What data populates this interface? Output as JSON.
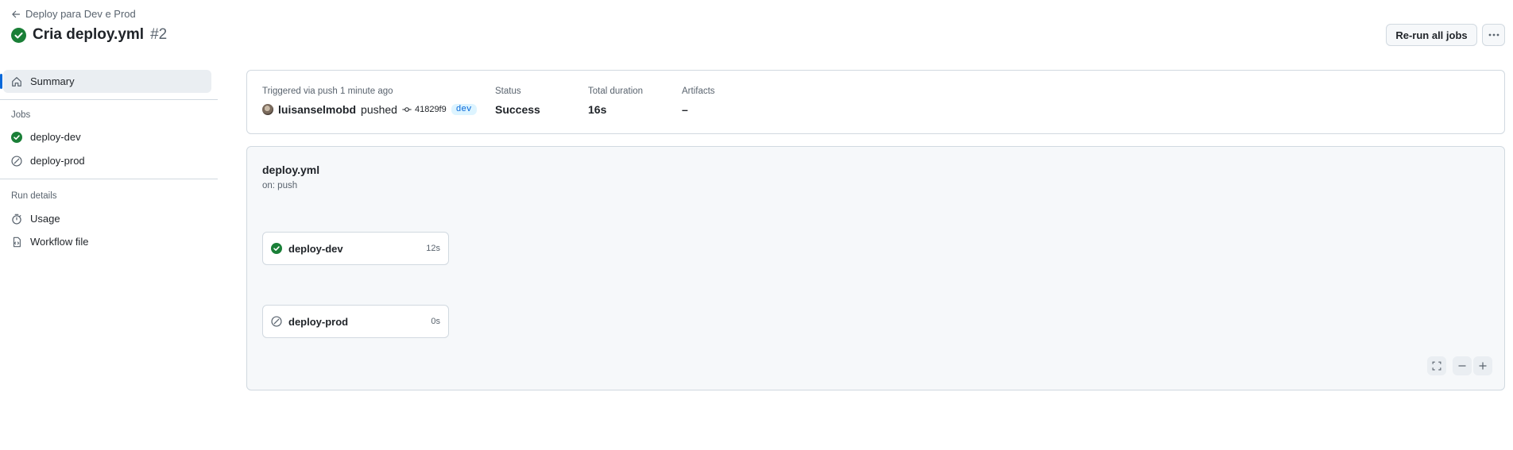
{
  "header": {
    "back_label": "Deploy para Dev e Prod",
    "title": "Cria deploy.yml",
    "run_number": "#2",
    "rerun_label": "Re-run all jobs"
  },
  "sidebar": {
    "summary_label": "Summary",
    "jobs_heading": "Jobs",
    "jobs": [
      {
        "label": "deploy-dev",
        "status": "success"
      },
      {
        "label": "deploy-prod",
        "status": "skipped"
      }
    ],
    "run_details_heading": "Run details",
    "run_details": [
      {
        "label": "Usage",
        "icon": "stopwatch-icon"
      },
      {
        "label": "Workflow file",
        "icon": "file-code-icon"
      }
    ]
  },
  "summary": {
    "trigger_label": "Triggered via push 1 minute ago",
    "user": "luisanselmobd",
    "action": "pushed",
    "commit": "41829f9",
    "branch": "dev",
    "status_label": "Status",
    "status_value": "Success",
    "duration_label": "Total duration",
    "duration_value": "16s",
    "artifacts_label": "Artifacts",
    "artifacts_value": "–"
  },
  "graph": {
    "workflow_name": "deploy.yml",
    "trigger": "on: push",
    "jobs": [
      {
        "label": "deploy-dev",
        "duration": "12s",
        "status": "success"
      },
      {
        "label": "deploy-prod",
        "duration": "0s",
        "status": "skipped"
      }
    ]
  },
  "colors": {
    "success": "#1a7f37",
    "skipped": "#59636e",
    "accent": "#0969da"
  }
}
